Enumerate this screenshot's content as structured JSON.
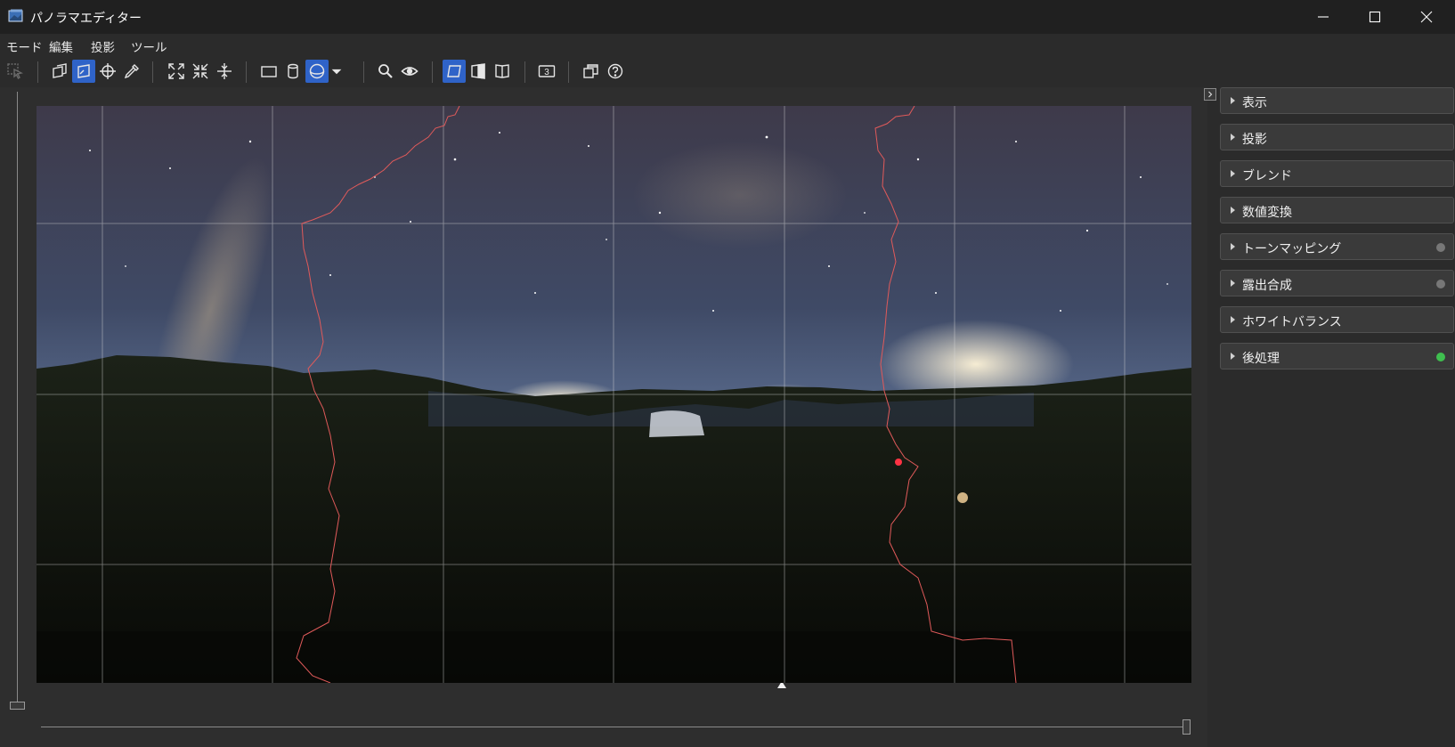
{
  "window": {
    "title": "パノラマエディター"
  },
  "menu": {
    "items": [
      "モード",
      "編集",
      "投影",
      "ツール"
    ]
  },
  "toolbar": {
    "counter_label": "3"
  },
  "panel": {
    "sections": [
      {
        "label": "表示",
        "indicator": null
      },
      {
        "label": "投影",
        "indicator": null
      },
      {
        "label": "ブレンド",
        "indicator": null
      },
      {
        "label": "数値変換",
        "indicator": null
      },
      {
        "label": "トーンマッピング",
        "indicator": "#777777"
      },
      {
        "label": "露出合成",
        "indicator": "#777777"
      },
      {
        "label": "ホワイトバランス",
        "indicator": null
      },
      {
        "label": "後処理",
        "indicator": "#3fbf4f"
      }
    ]
  },
  "colors": {
    "accent": "#2f63c8",
    "seam": "#e05a5a",
    "grid": "#d8d8d8"
  }
}
